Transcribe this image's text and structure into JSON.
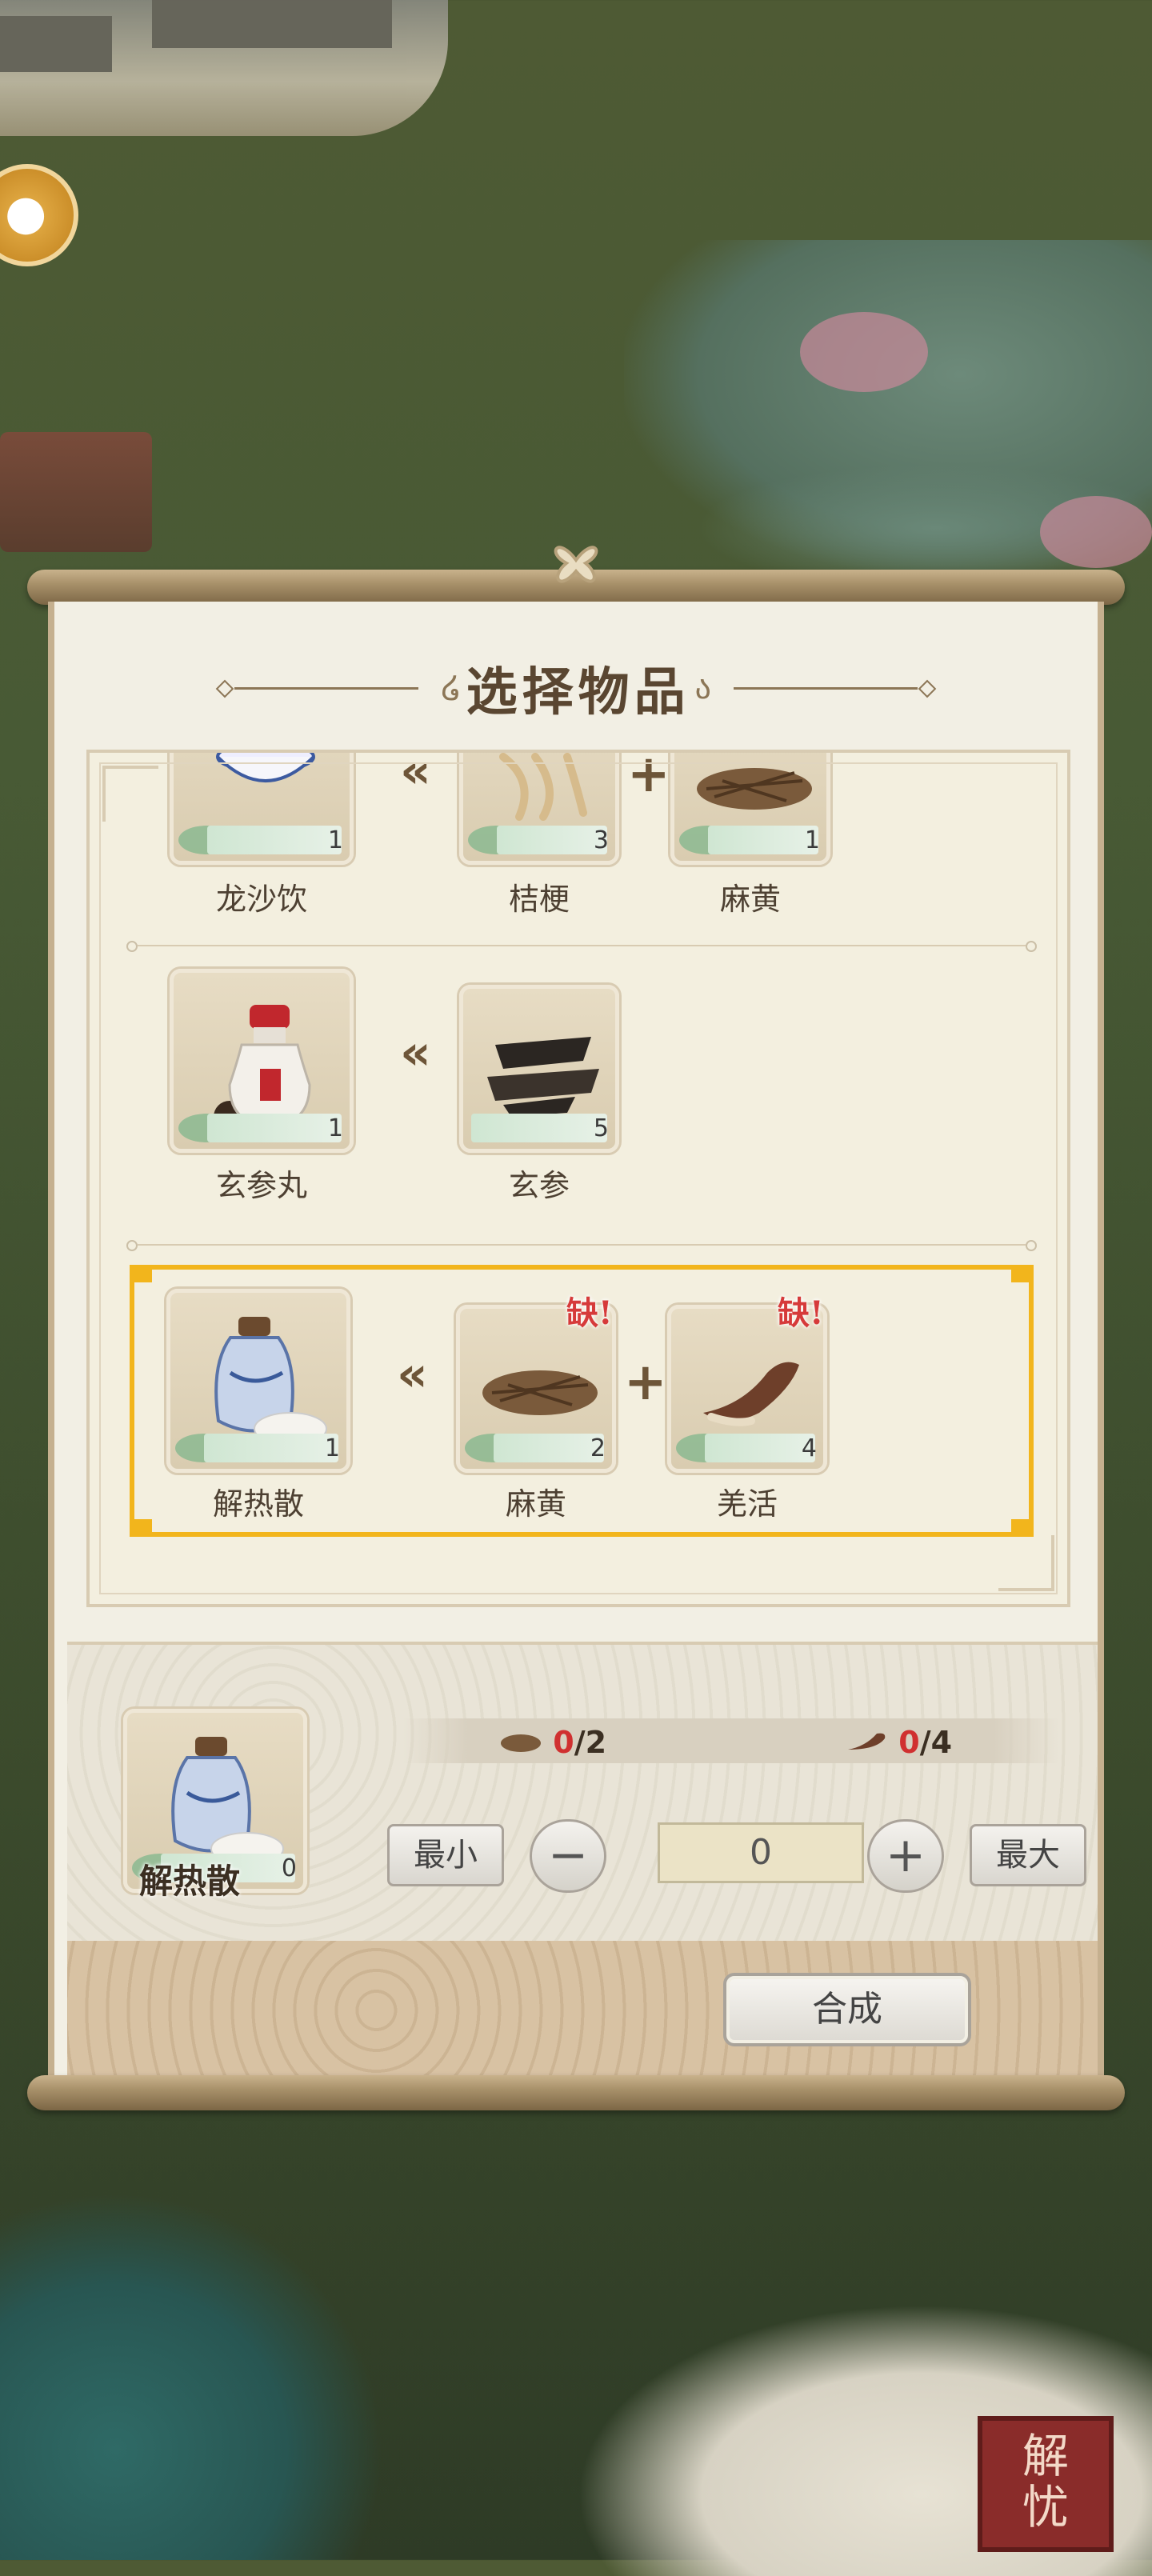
{
  "dialog": {
    "title": "选择物品"
  },
  "recipes": [
    {
      "output": {
        "name": "龙沙饮",
        "count": "1"
      },
      "inputs": [
        {
          "name": "桔梗",
          "count": "3"
        },
        {
          "name": "麻黄",
          "count": "1"
        }
      ]
    },
    {
      "output": {
        "name": "玄参丸",
        "count": "1"
      },
      "inputs": [
        {
          "name": "玄参",
          "count": "5"
        }
      ]
    },
    {
      "output": {
        "name": "解热散",
        "count": "1"
      },
      "inputs": [
        {
          "name": "麻黄",
          "count": "2",
          "lack": "缺!"
        },
        {
          "name": "羌活",
          "count": "4",
          "lack": "缺!"
        }
      ],
      "selected": true
    }
  ],
  "synthesis": {
    "item_name": "解热散",
    "item_count": "0",
    "requirements": [
      {
        "icon": "mahuang-icon",
        "have": "0",
        "need": "/2"
      },
      {
        "icon": "qianghuo-icon",
        "have": "0",
        "need": "/4"
      }
    ],
    "min_label": "最小",
    "max_label": "最大",
    "minus_label": "−",
    "plus_label": "+",
    "quantity": "0",
    "craft_label": "合成"
  },
  "stamp_text": "解忧",
  "colors": {
    "selection": "#f2b51c",
    "lack_red": "#d63a3a",
    "panel": "#f2efe4"
  }
}
